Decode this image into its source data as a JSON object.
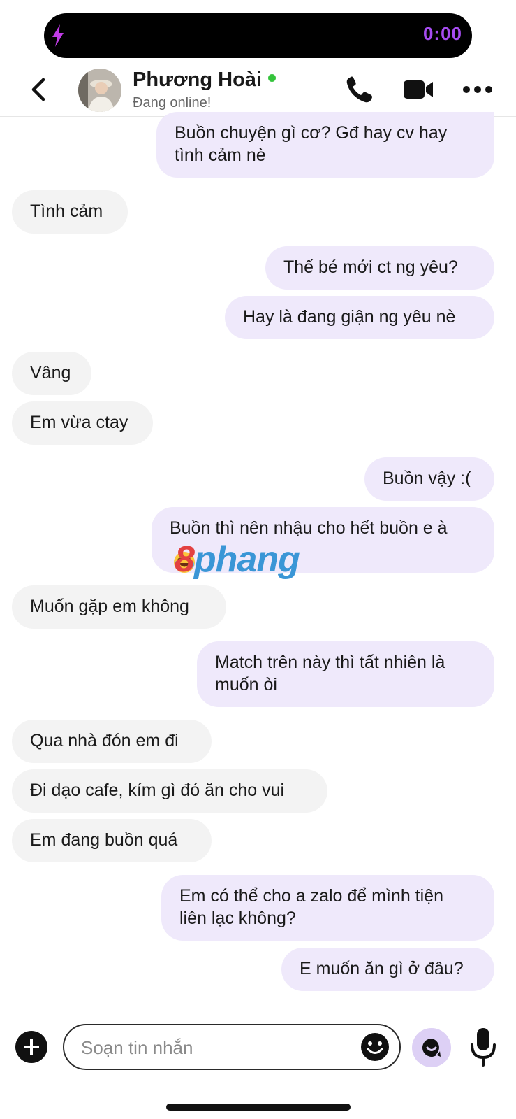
{
  "call_pill": {
    "timer": "0:00",
    "accent": "#a64cf0"
  },
  "header": {
    "name": "Phương Hoài",
    "status": "Đang online!",
    "icons": [
      "back-icon",
      "phone-icon",
      "video-icon",
      "more-icon"
    ]
  },
  "messages": [
    {
      "side": "out",
      "text": "Buồn chuyện gì cơ? Gđ hay cv hay\ntình cảm nè"
    },
    {
      "side": "in",
      "text": "Tình cảm"
    },
    {
      "side": "out",
      "text": "Thế bé mới ct ng yêu?"
    },
    {
      "side": "out",
      "text": "Hay là đang giận ng yêu nè"
    },
    {
      "side": "in",
      "text": "Vâng"
    },
    {
      "side": "in",
      "text": "Em vừa ctay"
    },
    {
      "side": "out",
      "text": "Buồn vậy :("
    },
    {
      "side": "out",
      "text": "Buồn thì nên nhậu cho hết buồn e à\n   "
    },
    {
      "side": "in",
      "text": "Muốn gặp em không"
    },
    {
      "side": "out",
      "text": "Match trên này thì tất nhiên là\nmuốn òi"
    },
    {
      "side": "in",
      "text": "Qua nhà đón em đi"
    },
    {
      "side": "in",
      "text": "Đi dạo cafe, kím gì đó ăn cho vui"
    },
    {
      "side": "in",
      "text": "Em đang buồn quá"
    },
    {
      "side": "out",
      "text": "Em có thể cho a zalo để mình tiện\nliên lạc không?"
    },
    {
      "side": "out",
      "text": "E muốn ăn gì ở đâu?"
    }
  ],
  "watermark": {
    "part1": "8",
    "part2": "phang"
  },
  "composer": {
    "placeholder": "Soạn tin nhắn",
    "value": ""
  },
  "colors": {
    "outgoing_bubble": "#efe9fb",
    "incoming_bubble": "#f3f3f3",
    "online": "#35c43c"
  }
}
